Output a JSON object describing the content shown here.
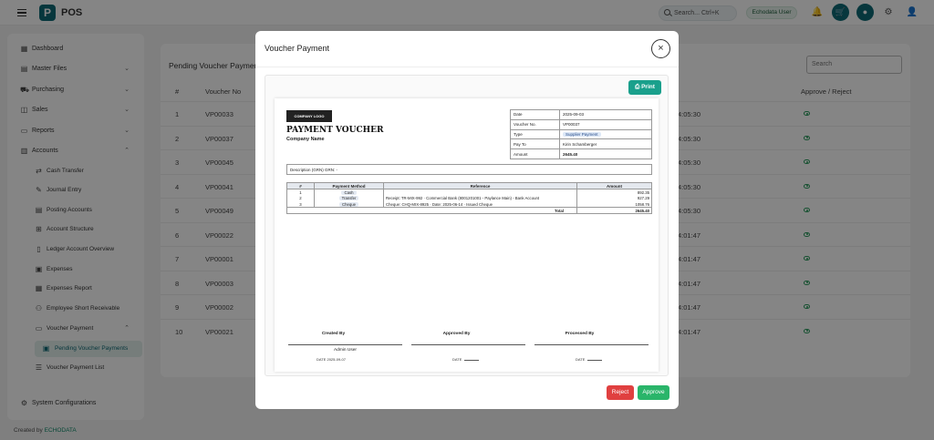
{
  "app": {
    "logo_letter": "P",
    "title": "POS"
  },
  "topbar": {
    "search_text": "Search...  Ctrl+K",
    "user_label": "Echodata User",
    "icons": [
      "bell-icon",
      "cart-icon",
      "brand-icon",
      "gear-icon",
      "user-icon"
    ]
  },
  "sidebar": {
    "items": [
      {
        "label": "Dashboard",
        "icon": "grid-icon"
      },
      {
        "label": "Master Files",
        "icon": "grid-icon",
        "chevron": "⌄"
      },
      {
        "label": "Purchasing",
        "icon": "cart-icon",
        "chevron": "⌄"
      },
      {
        "label": "Sales",
        "icon": "bag-icon",
        "chevron": "⌄"
      },
      {
        "label": "Reports",
        "icon": "file-icon",
        "chevron": "⌄"
      },
      {
        "label": "Accounts",
        "icon": "calculator-icon",
        "chevron": "⌃"
      },
      {
        "label": "Cash Transfer",
        "icon": "transfer-icon"
      },
      {
        "label": "Journal Entry",
        "icon": "pencil-icon"
      },
      {
        "label": "Posting Accounts",
        "icon": "doc-icon"
      },
      {
        "label": "Account Structure",
        "icon": "structure-icon"
      },
      {
        "label": "Ledger Account Overview",
        "icon": "book-icon"
      },
      {
        "label": "Expenses",
        "icon": "money-icon"
      },
      {
        "label": "Expenses Report",
        "icon": "chart-icon"
      },
      {
        "label": "Employee Short Receivable",
        "icon": "users-icon"
      },
      {
        "label": "Voucher Payment",
        "icon": "voucher-icon",
        "chevron": "⌃"
      },
      {
        "label": "Pending Voucher Payments",
        "icon": "pending-icon"
      },
      {
        "label": "Voucher Payment List",
        "icon": "list-icon"
      },
      {
        "label": "System Configurations",
        "icon": "gear-icon"
      }
    ]
  },
  "footer": {
    "prefix": "Created by ",
    "brand": "ECHODATA"
  },
  "main": {
    "title": "Pending Voucher Paymen",
    "search_placeholder": "Search",
    "headers": {
      "num": "#",
      "voucher": "Voucher No",
      "action": "Approve / Reject"
    },
    "rows": [
      {
        "num": "1",
        "voucher": "VP00033",
        "time": "4:05:30"
      },
      {
        "num": "2",
        "voucher": "VP00037",
        "time": "4:05:30"
      },
      {
        "num": "3",
        "voucher": "VP00045",
        "time": "4:05:30"
      },
      {
        "num": "4",
        "voucher": "VP00041",
        "time": "4:05:30"
      },
      {
        "num": "5",
        "voucher": "VP00049",
        "time": "4:05:30"
      },
      {
        "num": "6",
        "voucher": "VP00022",
        "time": "4:01:47"
      },
      {
        "num": "7",
        "voucher": "VP00001",
        "time": "4:01:47"
      },
      {
        "num": "8",
        "voucher": "VP00003",
        "time": "4:01:47"
      },
      {
        "num": "9",
        "voucher": "VP00002",
        "time": "4:01:47"
      },
      {
        "num": "10",
        "voucher": "VP00021",
        "time": "4:01:47"
      }
    ]
  },
  "modal": {
    "title": "Voucher Payment",
    "close": "×",
    "print_label": "⎙ Print",
    "reject_label": "Reject",
    "approve_label": "Approve",
    "voucher": {
      "logo_text": "COMPANY LOGO",
      "title": "PAYMENT VOUCHER",
      "company": "Company Name",
      "info": [
        {
          "key": "Date",
          "value": "2025-09-03"
        },
        {
          "key": "Voucher No.",
          "value": "VP00037"
        },
        {
          "key": "Type",
          "value": "Supplier Payment"
        },
        {
          "key": "Pay To",
          "value": "Kirin Schamberger"
        },
        {
          "key": "Amount",
          "value": "2645.40"
        }
      ],
      "description": "Description (GRN)   GRN: -",
      "table_headers": [
        "#",
        "Payment Method",
        "Reference",
        "Amount"
      ],
      "payments": [
        {
          "num": "1",
          "method": "Cash",
          "reference": "",
          "amount": "892.35"
        },
        {
          "num": "2",
          "method": "Transfer",
          "reference": "Receipt: TR-MIX-992 · Commercial Bank (8001201001 - Paylance Main) - Bank Account",
          "amount": "927.29"
        },
        {
          "num": "3",
          "method": "Cheque",
          "reference": "Cheque: CHQ-MIX-8925 · Date: 2025-06-14 · Issued Cheque",
          "amount": "1058.76"
        }
      ],
      "total_label": "Total",
      "total_value": "2645.40",
      "signatures": {
        "created_label": "Created By",
        "approved_label": "Approved By",
        "processed_label": "Processed By",
        "created_name": "Admin User",
        "created_date": "DATE  2025-09-07",
        "approved_date": "DATE",
        "processed_date": "DATE"
      }
    }
  }
}
